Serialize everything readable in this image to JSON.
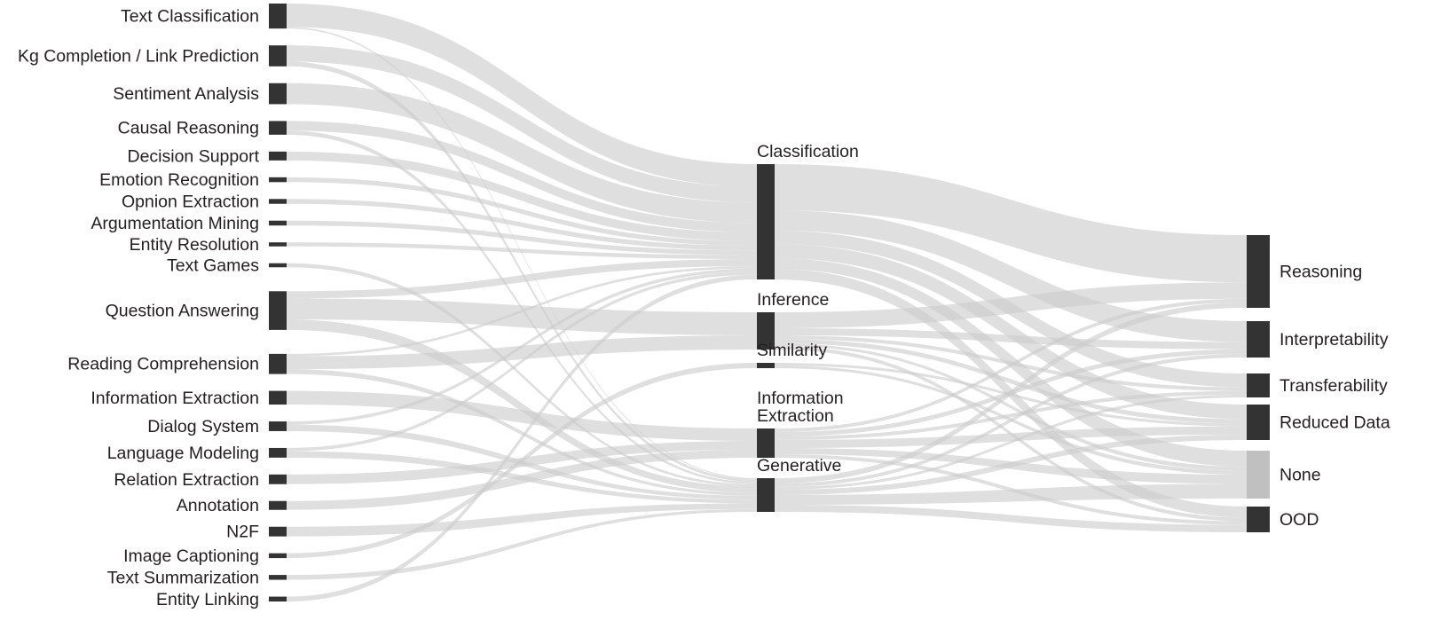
{
  "figure": {
    "type": "sankey",
    "title": "",
    "background_color": "#ffffff",
    "node_color": "#333333",
    "node_color_none": "#c0c0c0",
    "link_color": "#cccccc",
    "text_color": "#231f20",
    "columns": [
      "Task",
      "Problem Type",
      "Goal"
    ]
  },
  "stages": {
    "tasks": [
      {
        "id": "text_classification",
        "label": "Text Classification",
        "value": 31
      },
      {
        "id": "kg_completion",
        "label": "Kg Completion / Link Prediction",
        "value": 26
      },
      {
        "id": "sentiment_analysis",
        "label": "Sentiment Analysis",
        "value": 26
      },
      {
        "id": "causal_reasoning",
        "label": "Causal Reasoning",
        "value": 17
      },
      {
        "id": "decision_support",
        "label": "Decision Support",
        "value": 11
      },
      {
        "id": "emotion_recognition",
        "label": "Emotion Recognition",
        "value": 6
      },
      {
        "id": "opnion_extraction",
        "label": "Opnion Extraction",
        "value": 6
      },
      {
        "id": "argumentation_mining",
        "label": "Argumentation Mining",
        "value": 6
      },
      {
        "id": "entity_resolution",
        "label": "Entity Resolution",
        "value": 5
      },
      {
        "id": "text_games",
        "label": "Text Games",
        "value": 5
      },
      {
        "id": "question_answering",
        "label": "Question Answering",
        "value": 48
      },
      {
        "id": "reading_comprehension",
        "label": "Reading Comprehension",
        "value": 25
      },
      {
        "id": "information_extraction",
        "label": "Information Extraction",
        "value": 17
      },
      {
        "id": "dialog_system",
        "label": "Dialog System",
        "value": 12
      },
      {
        "id": "language_modeling",
        "label": "Language Modeling",
        "value": 12
      },
      {
        "id": "relation_extraction",
        "label": "Relation Extraction",
        "value": 12
      },
      {
        "id": "annotation",
        "label": "Annotation",
        "value": 11
      },
      {
        "id": "n2f",
        "label": "N2F",
        "value": 12
      },
      {
        "id": "image_captioning",
        "label": "Image Captioning",
        "value": 6
      },
      {
        "id": "text_summarization",
        "label": "Text Summarization",
        "value": 6
      },
      {
        "id": "entity_linking",
        "label": "Entity Linking",
        "value": 6
      }
    ],
    "problem_types": [
      {
        "id": "classification",
        "label": "Classification",
        "value": 130
      },
      {
        "id": "inference",
        "label": "Inference",
        "value": 42
      },
      {
        "id": "similarity",
        "label": "Similarity",
        "value": 6
      },
      {
        "id": "information_extraction_mid",
        "label": "Information\nExtraction",
        "value": 33
      },
      {
        "id": "generative",
        "label": "Generative",
        "value": 38
      }
    ],
    "goals": [
      {
        "id": "reasoning",
        "label": "Reasoning",
        "value": 80
      },
      {
        "id": "interpretability",
        "label": "Interpretability",
        "value": 40
      },
      {
        "id": "transferability",
        "label": "Transferability",
        "value": 26
      },
      {
        "id": "reduced_data",
        "label": "Reduced Data",
        "value": 39
      },
      {
        "id": "none",
        "label": "None",
        "value": 52
      },
      {
        "id": "ood",
        "label": "OOD",
        "value": 28
      }
    ]
  },
  "links_task_to_type": [
    {
      "source": "text_classification",
      "target": "classification",
      "value": 29
    },
    {
      "source": "text_classification",
      "target": "generative",
      "value": 2
    },
    {
      "source": "kg_completion",
      "target": "classification",
      "value": 20
    },
    {
      "source": "kg_completion",
      "target": "generative",
      "value": 6
    },
    {
      "source": "sentiment_analysis",
      "target": "classification",
      "value": 26
    },
    {
      "source": "causal_reasoning",
      "target": "classification",
      "value": 12
    },
    {
      "source": "causal_reasoning",
      "target": "generative",
      "value": 5
    },
    {
      "source": "decision_support",
      "target": "classification",
      "value": 11
    },
    {
      "source": "emotion_recognition",
      "target": "classification",
      "value": 6
    },
    {
      "source": "opnion_extraction",
      "target": "classification",
      "value": 6
    },
    {
      "source": "argumentation_mining",
      "target": "classification",
      "value": 6
    },
    {
      "source": "entity_resolution",
      "target": "classification",
      "value": 5
    },
    {
      "source": "text_games",
      "target": "generative",
      "value": 5
    },
    {
      "source": "question_answering",
      "target": "classification",
      "value": 9
    },
    {
      "source": "question_answering",
      "target": "inference",
      "value": 26
    },
    {
      "source": "question_answering",
      "target": "generative",
      "value": 13
    },
    {
      "source": "reading_comprehension",
      "target": "inference",
      "value": 16
    },
    {
      "source": "reading_comprehension",
      "target": "classification",
      "value": 3
    },
    {
      "source": "reading_comprehension",
      "target": "generative",
      "value": 6
    },
    {
      "source": "information_extraction",
      "target": "information_extraction_mid",
      "value": 17
    },
    {
      "source": "dialog_system",
      "target": "generative",
      "value": 8
    },
    {
      "source": "dialog_system",
      "target": "classification",
      "value": 4
    },
    {
      "source": "language_modeling",
      "target": "generative",
      "value": 8
    },
    {
      "source": "language_modeling",
      "target": "classification",
      "value": 4
    },
    {
      "source": "relation_extraction",
      "target": "information_extraction_mid",
      "value": 12
    },
    {
      "source": "annotation",
      "target": "information_extraction_mid",
      "value": 11
    },
    {
      "source": "n2f",
      "target": "generative",
      "value": 12
    },
    {
      "source": "image_captioning",
      "target": "similarity",
      "value": 6
    },
    {
      "source": "text_summarization",
      "target": "generative",
      "value": 6
    },
    {
      "source": "entity_linking",
      "target": "classification",
      "value": 6
    }
  ],
  "links_type_to_goal": [
    {
      "source": "classification",
      "target": "reasoning",
      "value": 52
    },
    {
      "source": "classification",
      "target": "interpretability",
      "value": 23
    },
    {
      "source": "classification",
      "target": "transferability",
      "value": 15
    },
    {
      "source": "classification",
      "target": "reduced_data",
      "value": 16
    },
    {
      "source": "classification",
      "target": "none",
      "value": 12
    },
    {
      "source": "classification",
      "target": "ood",
      "value": 12
    },
    {
      "source": "inference",
      "target": "reasoning",
      "value": 18
    },
    {
      "source": "inference",
      "target": "interpretability",
      "value": 8
    },
    {
      "source": "inference",
      "target": "transferability",
      "value": 4
    },
    {
      "source": "inference",
      "target": "reduced_data",
      "value": 5
    },
    {
      "source": "inference",
      "target": "none",
      "value": 3
    },
    {
      "source": "inference",
      "target": "ood",
      "value": 4
    },
    {
      "source": "similarity",
      "target": "reduced_data",
      "value": 3
    },
    {
      "source": "similarity",
      "target": "none",
      "value": 3
    },
    {
      "source": "information_extraction_mid",
      "target": "reasoning",
      "value": 4
    },
    {
      "source": "information_extraction_mid",
      "target": "interpretability",
      "value": 5
    },
    {
      "source": "information_extraction_mid",
      "target": "transferability",
      "value": 4
    },
    {
      "source": "information_extraction_mid",
      "target": "reduced_data",
      "value": 9
    },
    {
      "source": "information_extraction_mid",
      "target": "none",
      "value": 7
    },
    {
      "source": "information_extraction_mid",
      "target": "ood",
      "value": 4
    },
    {
      "source": "generative",
      "target": "reasoning",
      "value": 6
    },
    {
      "source": "generative",
      "target": "interpretability",
      "value": 4
    },
    {
      "source": "generative",
      "target": "transferability",
      "value": 3
    },
    {
      "source": "generative",
      "target": "reduced_data",
      "value": 6
    },
    {
      "source": "generative",
      "target": "none",
      "value": 11
    },
    {
      "source": "generative",
      "target": "ood",
      "value": 8
    }
  ],
  "chart_data": {
    "type": "sankey",
    "title": "",
    "levels": [
      "Task",
      "Problem Type",
      "Goal"
    ],
    "nodes": [
      "Text Classification",
      "Kg Completion / Link Prediction",
      "Sentiment Analysis",
      "Causal Reasoning",
      "Decision Support",
      "Emotion Recognition",
      "Opnion Extraction",
      "Argumentation Mining",
      "Entity Resolution",
      "Text Games",
      "Question Answering",
      "Reading Comprehension",
      "Information Extraction",
      "Dialog System",
      "Language Modeling",
      "Relation Extraction",
      "Annotation",
      "N2F",
      "Image Captioning",
      "Text Summarization",
      "Entity Linking",
      "Classification",
      "Inference",
      "Similarity",
      "Information Extraction",
      "Generative",
      "Reasoning",
      "Interpretability",
      "Transferability",
      "Reduced Data",
      "None",
      "OOD"
    ],
    "legend": [],
    "grid": false
  }
}
